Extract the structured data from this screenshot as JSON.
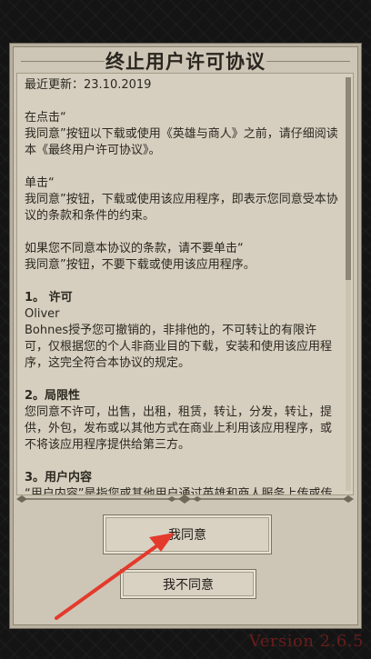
{
  "dialog": {
    "title": "终止用户许可协议",
    "last_update": "最近更新：23.10.2019",
    "paragraphs": [
      "在点击“\n我同意”按钮以下载或使用《英雄与商人》之前，请仔细阅读本《最终用户许可协议》。",
      "单击“\n我同意”按钮，下载或使用该应用程序，即表示您同意受本协议的条款和条件的约束。",
      "如果您不同意本协议的条款，请不要单击“\n我同意”按钮，不要下载或使用该应用程序。"
    ],
    "sections": [
      {
        "heading": "1。 许可",
        "body": "Oliver\nBohnes授予您可撤销的，非排他的，不可转让的有限许可，仅根据您的个人非商业目的下载，安装和使用该应用程序，这完全符合本协议的规定。"
      },
      {
        "heading": "2。局限性",
        "body": "您同意不许可，出售，出租，租赁，转让，分发，转让，提供，外包，发布或以其他方式在商业上利用该应用程序，或不将该应用程序提供给第三方。"
      },
      {
        "heading": "3。用户内容",
        "body": "“用户内容”是指您或其他用户通过英雄和商人服务上传或传输的所有通信和资料，数据和信息。"
      }
    ],
    "scroll_fraction": 0.49
  },
  "buttons": {
    "agree": "我同意",
    "disagree": "我不同意"
  },
  "version": "Version 2.6.5",
  "colors": {
    "background": "#141414",
    "parchment": "#cdc6b6",
    "arrow": "#e33a2c",
    "version_text": "#6b1c1c"
  }
}
